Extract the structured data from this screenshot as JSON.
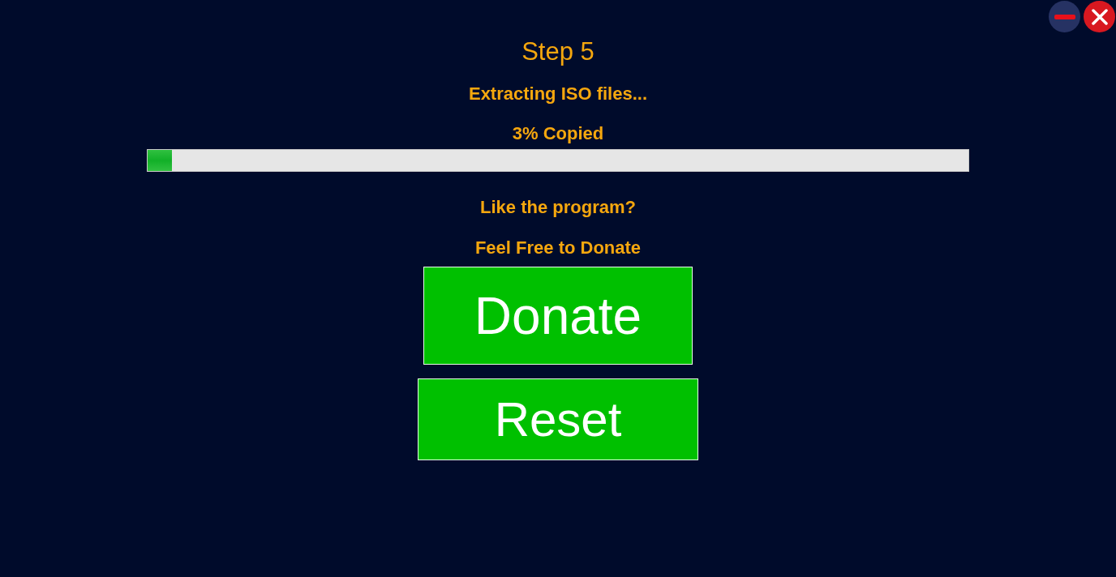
{
  "title": "Step 5",
  "status": "Extracting ISO files...",
  "progress": {
    "reading": "3% Copied",
    "level": 0.03
  },
  "prompt": "Like the program?",
  "invitation": "Feel Free to Donate",
  "buttons": [
    {
      "label": "Donate",
      "kind": "donate"
    },
    {
      "label": "Reset",
      "kind": "reset"
    }
  ]
}
